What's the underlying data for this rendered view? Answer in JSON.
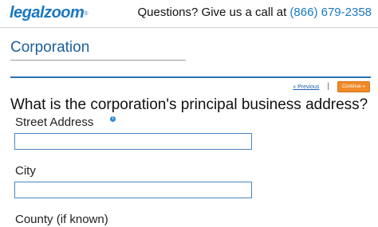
{
  "header": {
    "logo_legal": "legal",
    "logo_zoom": "zoom",
    "logo_reg": "®",
    "contact_text": "Questions? Give us a call at",
    "phone": "(866) 679-2358"
  },
  "section": {
    "title": "Corporation"
  },
  "nav": {
    "previous_label": "« Previous",
    "separator": "|",
    "continue_label": "Continue »"
  },
  "form": {
    "question": "What is the corporation's principal business address?",
    "info_icon_glyph": "i",
    "fields": [
      {
        "label": "Street Address",
        "value": ""
      },
      {
        "label": "City",
        "value": ""
      },
      {
        "label": "County (if known)",
        "value": ""
      }
    ]
  },
  "colors": {
    "brand_blue": "#1a78c2",
    "title_blue": "#1d5f9e",
    "continue_orange": "#f08a2a"
  }
}
